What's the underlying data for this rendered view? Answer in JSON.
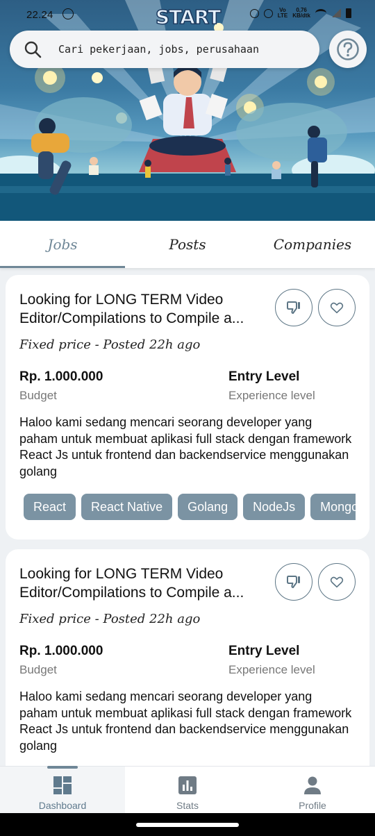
{
  "status_bar": {
    "time": "22.24",
    "network_label": "Vo\nLTE",
    "speed": "0,76\nKB/dtk"
  },
  "header": {
    "logo_text": "START",
    "search": {
      "placeholder": "Cari pekerjaan, jobs, perusahaan"
    },
    "help_icon": "question-circle-icon"
  },
  "tabs": [
    {
      "label": "Jobs",
      "active": true
    },
    {
      "label": "Posts",
      "active": false
    },
    {
      "label": "Companies",
      "active": false
    }
  ],
  "jobs": [
    {
      "title": "Looking for LONG TERM Video Editor/Compilations to Compile a...",
      "meta": "Fixed price - Posted 22h ago",
      "budget": "Rp. 1.000.000",
      "budget_label": "Budget",
      "experience": "Entry Level",
      "experience_label": "Experience level",
      "description": "Haloo kami sedang mencari seorang developer yang paham untuk membuat aplikasi full stack dengan framework React Js untuk frontend dan backendservice menggunakan golang",
      "skills": [
        "React",
        "React Native",
        "Golang",
        "NodeJs",
        "Mongol"
      ]
    },
    {
      "title": "Looking for LONG TERM Video Editor/Compilations to Compile a...",
      "meta": "Fixed price - Posted 22h ago",
      "budget": "Rp. 1.000.000",
      "budget_label": "Budget",
      "experience": "Entry Level",
      "experience_label": "Experience level",
      "description": "Haloo kami sedang mencari seorang developer yang paham untuk membuat aplikasi full stack dengan framework React Js untuk frontend dan backendservice menggunakan golang"
    }
  ],
  "bottom_nav": [
    {
      "label": "Dashboard",
      "icon": "dashboard-icon",
      "active": true
    },
    {
      "label": "Stats",
      "icon": "stats-icon",
      "active": false
    },
    {
      "label": "Profile",
      "icon": "profile-icon",
      "active": false
    }
  ],
  "colors": {
    "accent": "#6f8797",
    "chip": "#7b93a3",
    "card": "#ffffff",
    "background": "#eef1f4"
  }
}
